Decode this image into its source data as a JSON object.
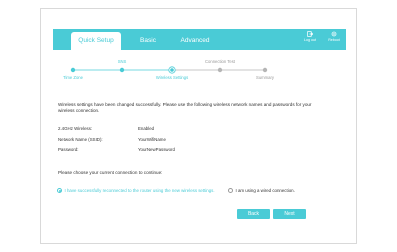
{
  "tabs": [
    {
      "label": "Quick Setup",
      "active": true
    },
    {
      "label": "Basic",
      "active": false
    },
    {
      "label": "Advanced",
      "active": false
    }
  ],
  "toolbar": {
    "logout_label": "Log out",
    "logout_icon": "logout-icon",
    "reboot_label": "Reboot",
    "reboot_icon": "reboot-icon"
  },
  "steps": [
    {
      "label": "Time Zone",
      "state": "done"
    },
    {
      "label": "SNS",
      "state": "done"
    },
    {
      "label": "Wireless Settings",
      "state": "current"
    },
    {
      "label": "Connection Test",
      "state": "todo"
    },
    {
      "label": "Summary",
      "state": "todo"
    }
  ],
  "message": "Wireless settings have been changed successfully. Please use the following wireless network names and passwords for your wireless connection.",
  "settings": [
    {
      "label": "2.4GHz Wireless:",
      "value": "Enabled"
    },
    {
      "label": "Network Name (SSID):",
      "value": "YourWifiName"
    },
    {
      "label": "Password:",
      "value": "YourNewPassword"
    }
  ],
  "prompt": "Please choose your current connection to continue:",
  "options": [
    {
      "label": "I have successfully reconnected to the router using the new wireless settings.",
      "checked": true
    },
    {
      "label": "I am using a wired connection.",
      "checked": false
    }
  ],
  "buttons": {
    "back": "Back",
    "next": "Next"
  },
  "colors": {
    "accent": "#4acbd6",
    "inactive": "#b5b5b5"
  }
}
